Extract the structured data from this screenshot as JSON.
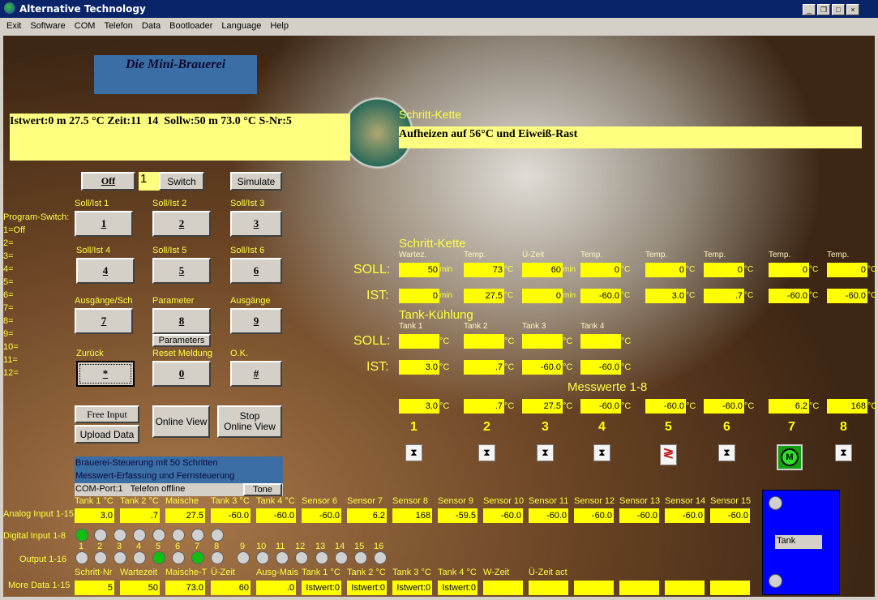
{
  "window": {
    "title": "Alternative Technology",
    "controls": [
      "_",
      "❐",
      "□",
      "×"
    ]
  },
  "menu": [
    "Exit",
    "Software",
    "COM",
    "Telefon",
    "Data",
    "Bootloader",
    "Language",
    "Help"
  ],
  "header": {
    "title": "Die Mini-Brauerei",
    "status": "Istwert:0 m 27.5 °C Zeit:11  14  Sollw:50 m 73.0 °C S-Nr:5",
    "step_label": "Schritt-Kette",
    "step_text": "Aufheizen auf 56°C und Eiweiß-Rast"
  },
  "controls": {
    "off": "Off",
    "switch_value": "1",
    "switch": "Switch",
    "simulate": "Simulate",
    "parameters": "Parameters"
  },
  "program_switch": [
    "Program-Switch:",
    "1=Off",
    "2=",
    "3=",
    "4=",
    "5=",
    "6=",
    "7=",
    "8=",
    "9=",
    "10=",
    "11=",
    "12="
  ],
  "keypad": [
    {
      "label": "Soll/Ist 1",
      "key": "1"
    },
    {
      "label": "Soll/Ist 2",
      "key": "2"
    },
    {
      "label": "Soll/Ist 3",
      "key": "3"
    },
    {
      "label": "Soll/Ist 4",
      "key": "4"
    },
    {
      "label": "Soll/Ist 5",
      "key": "5"
    },
    {
      "label": "Soll/Ist 6",
      "key": "6"
    },
    {
      "label": "Ausgänge/Sch",
      "key": "7"
    },
    {
      "label": "Parameter",
      "key": "8"
    },
    {
      "label": "Ausgänge",
      "key": "9"
    },
    {
      "label": "Zurück",
      "key": "*"
    },
    {
      "label": "Reset Meldung",
      "key": "0"
    },
    {
      "label": "O.K.",
      "key": "#"
    }
  ],
  "actions": {
    "free_input": "Free Input",
    "upload_data": "Upload Data",
    "online_view": "Online View",
    "stop_online_view_1": "Stop",
    "stop_online_view_2": "Online View"
  },
  "info": {
    "line1": "Brauerei-Steuerung mit 50 Schritten",
    "line2": "Messwert-Erfassung und Fernsteuerung",
    "com": "COM-Port:1   Telefon offline",
    "tone": "Tone"
  },
  "schritt": {
    "title": "Schritt-Kette",
    "soll_label": "SOLL:",
    "ist_label": "IST:",
    "columns": [
      {
        "label": "Wartez.",
        "soll": "50",
        "ist": "0",
        "unit": "min"
      },
      {
        "label": "Temp.",
        "soll": "73",
        "ist": "27.5",
        "unit": "°C"
      },
      {
        "label": "Ü-Zeit",
        "soll": "60",
        "ist": "0",
        "unit": "min"
      },
      {
        "label": "Temp.",
        "soll": "0",
        "ist": "-60.0",
        "unit": "°C"
      },
      {
        "label": "Temp.",
        "soll": "0",
        "ist": "3.0",
        "unit": "°C"
      },
      {
        "label": "Temp.",
        "soll": "0",
        "ist": ".7",
        "unit": "°C"
      },
      {
        "label": "Temp.",
        "soll": "0",
        "ist": "-60.0",
        "unit": "°C"
      },
      {
        "label": "Temp.",
        "soll": "0",
        "ist": "-60.0",
        "unit": "°C"
      }
    ]
  },
  "tank": {
    "title": "Tank-Kühlung",
    "soll_label": "SOLL:",
    "ist_label": "IST:",
    "unit": "°C",
    "columns": [
      {
        "label": "Tank 1",
        "soll": "",
        "ist": "3.0"
      },
      {
        "label": "Tank 2",
        "soll": "",
        "ist": ".7"
      },
      {
        "label": "Tank 3",
        "soll": "",
        "ist": "-60.0"
      },
      {
        "label": "Tank 4",
        "soll": "",
        "ist": "-60.0"
      }
    ]
  },
  "messwerte": {
    "title": "Messwerte 1-8",
    "unit": "°C",
    "values": [
      "3.0",
      ".7",
      "27.5",
      "-60.0",
      "-60.0",
      "-60.0",
      "6.2",
      "168"
    ]
  },
  "outputs": [
    {
      "num": "1",
      "icon": "valve-icon"
    },
    {
      "num": "2",
      "icon": "valve-icon"
    },
    {
      "num": "3",
      "icon": "valve-icon"
    },
    {
      "num": "4",
      "icon": "valve-icon"
    },
    {
      "num": "5",
      "icon": "heater-icon",
      "color": "#c02020"
    },
    {
      "num": "6",
      "icon": "valve-icon"
    },
    {
      "num": "7",
      "icon": "motor-icon",
      "color": "#10a010"
    },
    {
      "num": "8",
      "icon": "valve-icon"
    }
  ],
  "analog": {
    "label": "Analog Input 1-15",
    "names": [
      "Tank 1 °C",
      "Tank 2 °C",
      "Maische",
      "Tank 3 °C",
      "Tank 4 °C",
      "Sensor 6",
      "Sensor 7",
      "Sensor 8",
      "Sensor 9",
      "Sensor 10",
      "Sensor 11",
      "Sensor 12",
      "Sensor 13",
      "Sensor 14",
      "Sensor 15"
    ],
    "values": [
      "3.0",
      ".7",
      "27.5",
      "-60.0",
      "-60.0",
      "-60.0",
      "6.2",
      "168",
      "-59.5",
      "-60.0",
      "-60.0",
      "-60.0",
      "-60.0",
      "-60.0",
      "-60.0"
    ]
  },
  "digital": {
    "label": "Digital Input 1-8",
    "states": [
      1,
      0,
      0,
      0,
      0,
      0,
      0,
      0
    ]
  },
  "output_states": {
    "label": "Output 1-16",
    "numbers": [
      "1",
      "2",
      "3",
      "4",
      "5",
      "6",
      "7",
      "8",
      "9",
      "10",
      "11",
      "12",
      "13",
      "14",
      "15",
      "16"
    ],
    "states": [
      0,
      0,
      0,
      0,
      1,
      0,
      1,
      0,
      0,
      0,
      0,
      0,
      0,
      0,
      0,
      0
    ]
  },
  "more": {
    "label": "More Data 1-15",
    "names": [
      "Schritt-Nr",
      "Wartezeit",
      "Maische-T",
      "Ü-Zeit",
      "Ausg-Mais",
      "Tank 1 °C",
      "Tank 2 °C",
      "Tank 3 °C",
      "Tank 4 °C",
      "W-Zeit",
      "Ü-Zeit act",
      "",
      "",
      "",
      ""
    ],
    "values": [
      "5",
      "50",
      "73.0",
      "60",
      ".0",
      "Istwert:0",
      "Istwert:0",
      "Istwert:0",
      "Istwert:0",
      "",
      "",
      "",
      "",
      "",
      ""
    ]
  },
  "tank_panel": {
    "label": "Tank"
  },
  "colors": {
    "field": "#ffff00",
    "label": "#ffff40",
    "panel_blue": "#0000ff",
    "title_blue": "#3a6ea5",
    "on": "#10c010"
  }
}
